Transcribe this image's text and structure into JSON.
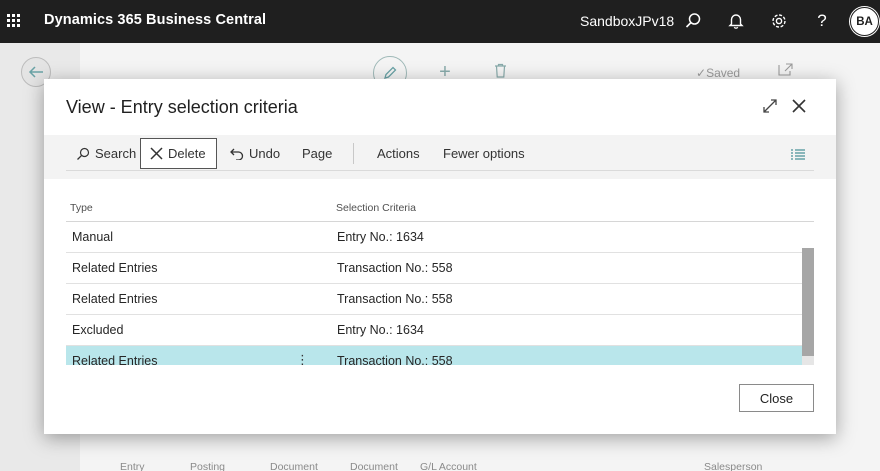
{
  "topbar": {
    "app_title": "Dynamics 365 Business Central",
    "environment": "SandboxJPv18",
    "avatar_initials": "BA",
    "icons": [
      "waffle-icon",
      "search-icon",
      "bell-icon",
      "gear-icon",
      "help-icon"
    ]
  },
  "background_page": {
    "saved_label": "Saved",
    "columns": [
      "Entry",
      "Posting",
      "Document",
      "Document",
      "G/L Account",
      "Salesperson"
    ]
  },
  "dialog": {
    "title": "View - Entry selection criteria",
    "actions": {
      "search": "Search",
      "delete": "Delete",
      "undo": "Undo",
      "page": "Page",
      "actions": "Actions",
      "fewer_options": "Fewer options"
    },
    "table": {
      "headers": {
        "type": "Type",
        "criteria": "Selection Criteria"
      },
      "rows": [
        {
          "type": "Manual",
          "criteria": "Entry No.: 1634"
        },
        {
          "type": "Related Entries",
          "criteria": "Transaction No.: 558"
        },
        {
          "type": "Related Entries",
          "criteria": "Transaction No.: 558"
        },
        {
          "type": "Excluded",
          "criteria": "Entry No.: 1634"
        },
        {
          "type": "Related Entries",
          "criteria": "Transaction No.: 558",
          "selected": true
        }
      ]
    },
    "close_button": "Close"
  },
  "colors": {
    "topbar": "#1f1f1f",
    "selected_row": "#b9e6eb",
    "accent": "#008489"
  }
}
